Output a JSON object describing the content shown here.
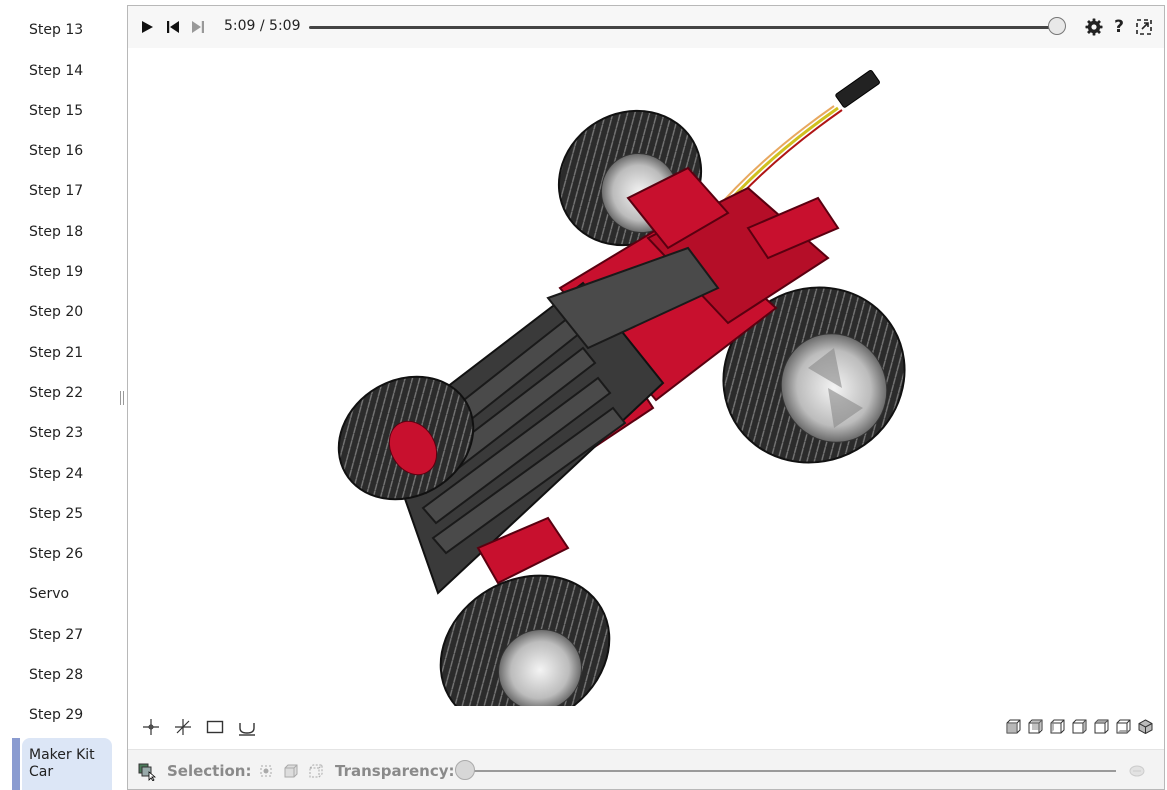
{
  "sidebar": {
    "items": [
      {
        "label": "Step 13"
      },
      {
        "label": "Step 14"
      },
      {
        "label": "Step 15"
      },
      {
        "label": "Step 16"
      },
      {
        "label": "Step 17"
      },
      {
        "label": "Step 18"
      },
      {
        "label": "Step 19"
      },
      {
        "label": "Step 20"
      },
      {
        "label": "Step 21"
      },
      {
        "label": "Step 22"
      },
      {
        "label": "Step 23"
      },
      {
        "label": "Step 24"
      },
      {
        "label": "Step 25"
      },
      {
        "label": "Step 26"
      },
      {
        "label": "Servo"
      },
      {
        "label": "Step 27"
      },
      {
        "label": "Step 28"
      },
      {
        "label": "Step 29"
      }
    ],
    "active_item": "Maker Kit Car"
  },
  "player": {
    "time": "5:09 / 5:09",
    "progress": 1.0,
    "icons": [
      "play-icon",
      "rewind-icon",
      "step-forward-icon",
      "settings-icon",
      "help-icon",
      "fullscreen-icon"
    ],
    "help_glyph": "?"
  },
  "bottom_tools": {
    "icons": [
      "pan-icon",
      "rotate-icon",
      "zoom-window-icon",
      "fit-icon"
    ],
    "views": [
      "front-view-icon",
      "back-view-icon",
      "left-view-icon",
      "right-view-icon",
      "top-view-icon",
      "bottom-view-icon",
      "iso-view-icon"
    ]
  },
  "selection": {
    "label": "Selection:",
    "transparency_label": "Transparency:",
    "transparency": 0.0
  },
  "colors": {
    "accent_red": "#c8102e",
    "dark_part": "#3a3a3a",
    "sidebar_active_bg": "#dce6f6",
    "sidebar_active_bar": "#8a9bd0"
  }
}
